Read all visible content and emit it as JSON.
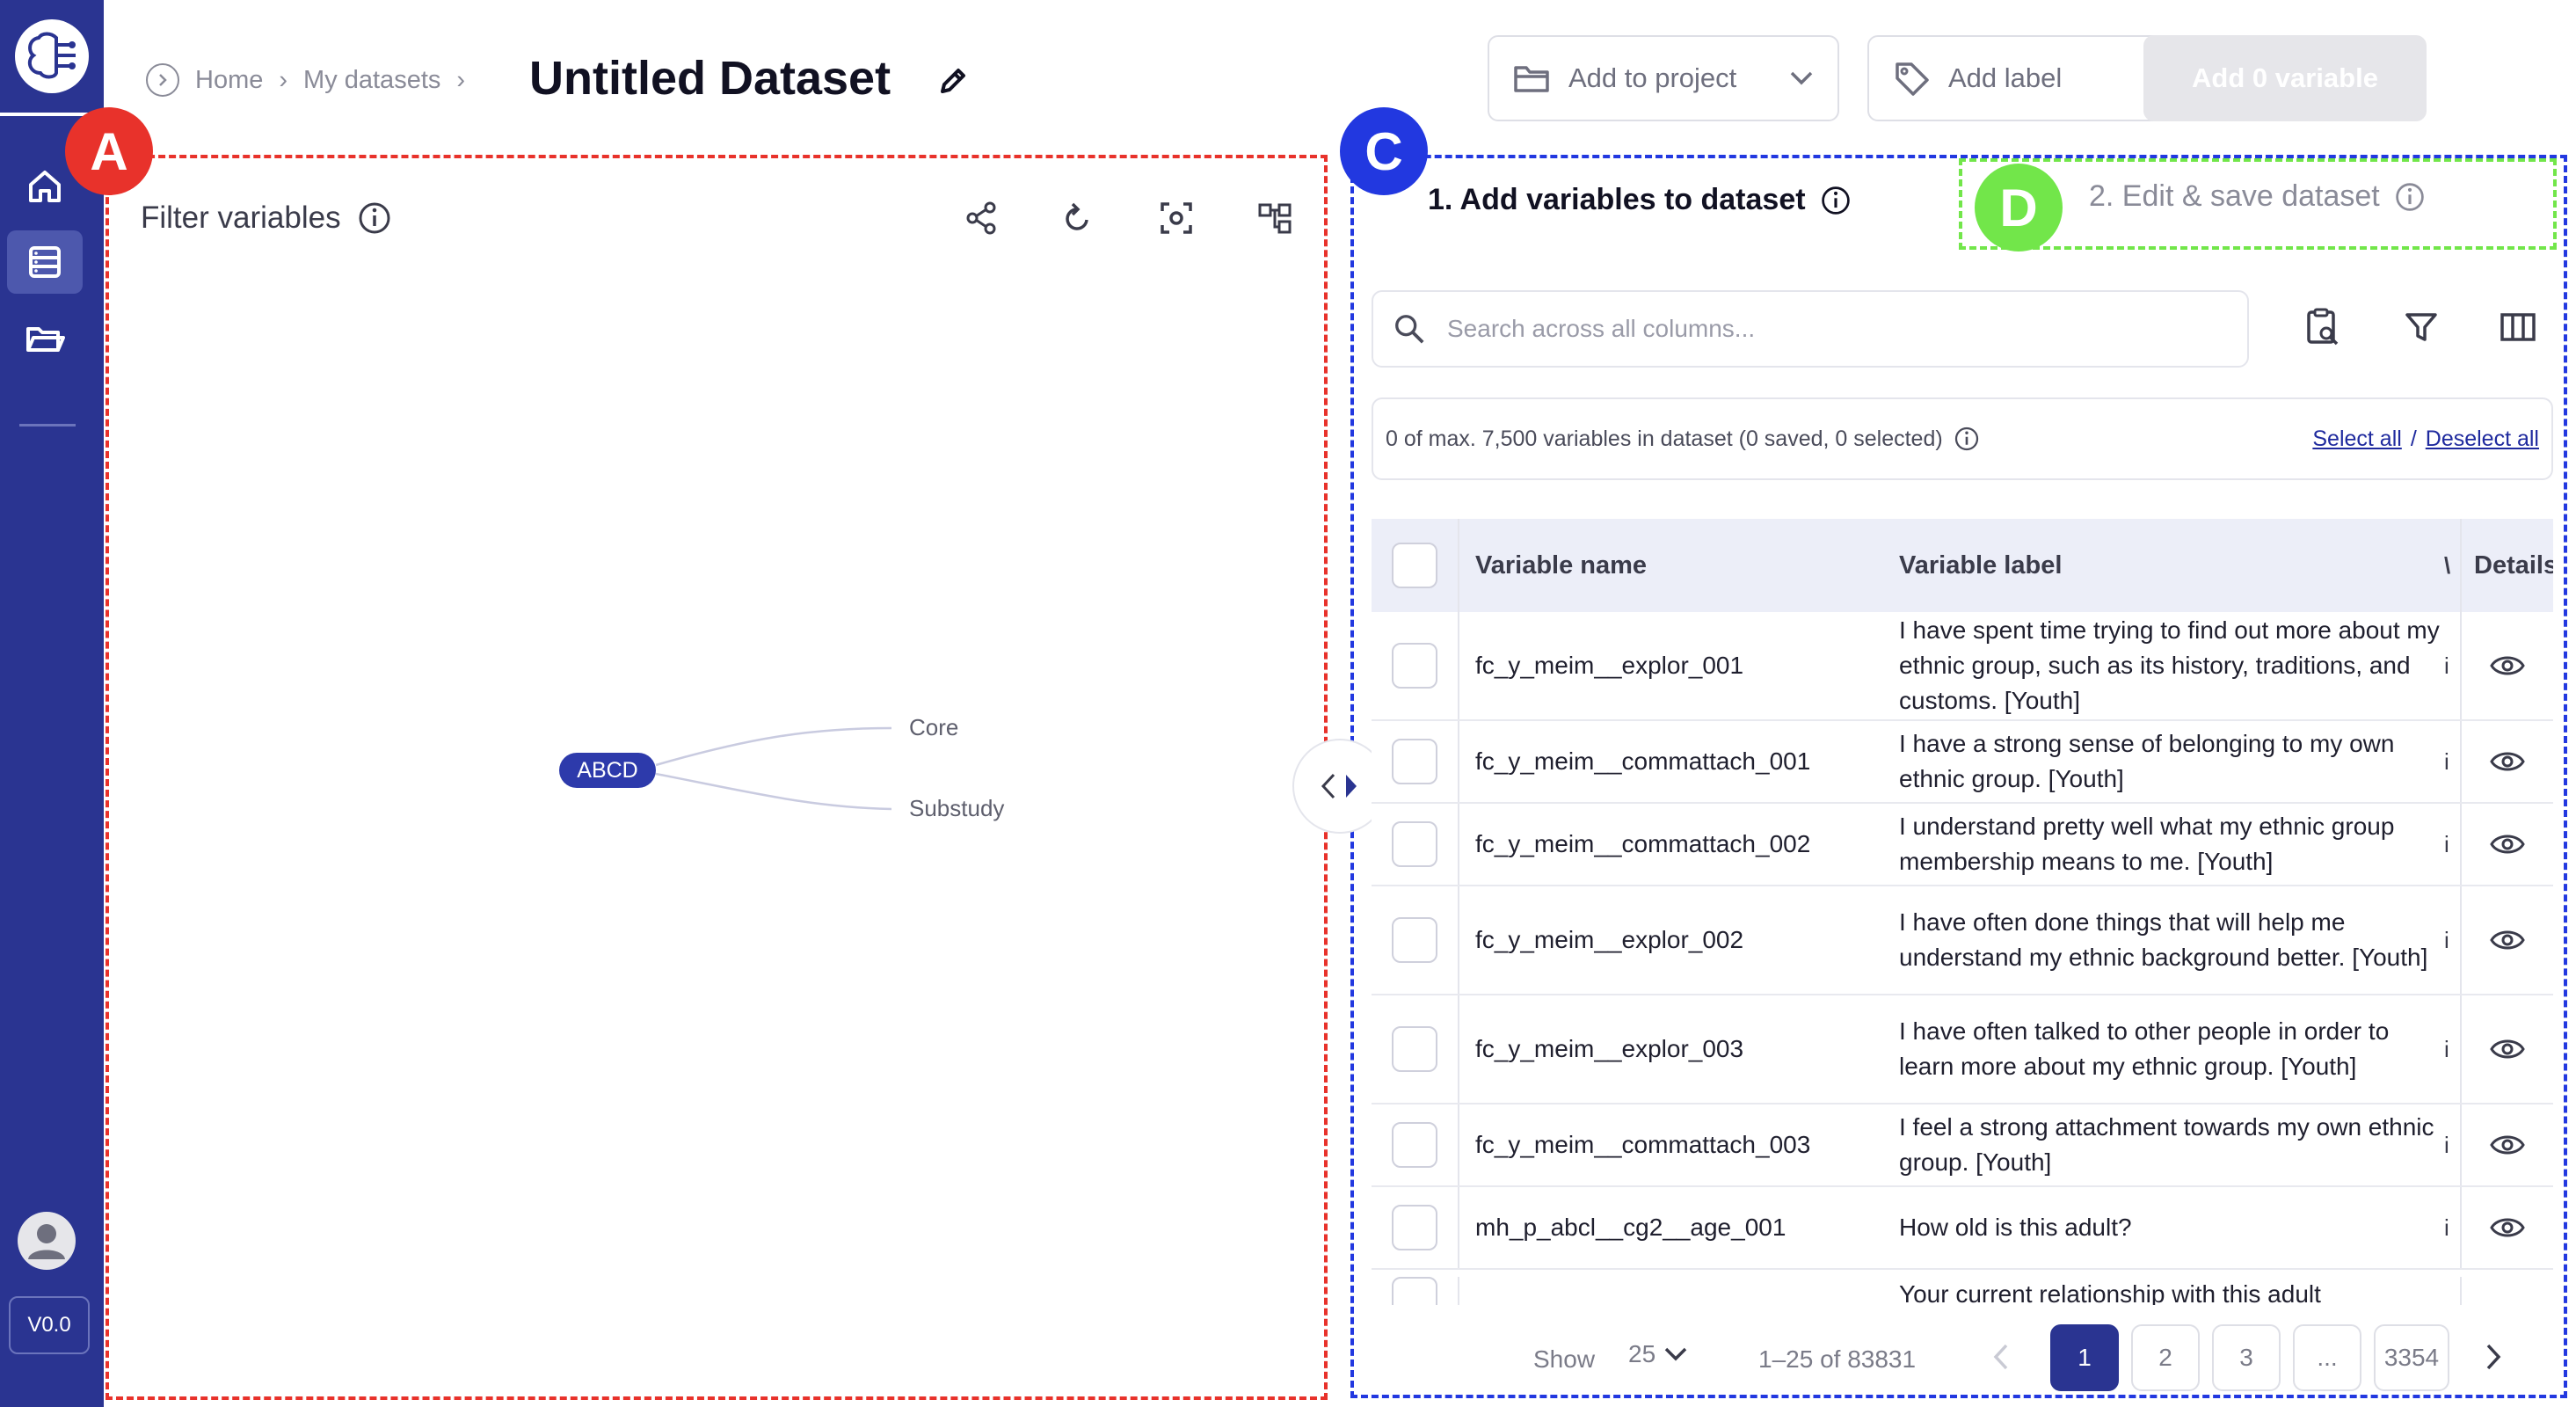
{
  "app": {
    "version": "V0.0"
  },
  "sidebar": {
    "items": [
      {
        "icon": "home-icon"
      },
      {
        "icon": "dataset-list-icon"
      },
      {
        "icon": "folder-icon"
      }
    ]
  },
  "header": {
    "breadcrumb": [
      "Home",
      "My datasets"
    ],
    "separator": "›",
    "title": "Untitled Dataset",
    "add_project": "Add to project",
    "add_label": "Add label",
    "add_variable": "Add 0 variable"
  },
  "annotations": {
    "a": "A",
    "c": "C",
    "d": "D"
  },
  "annotation_colors": {
    "a": "#e8322b",
    "c": "#2238e0",
    "d": "#72e64a"
  },
  "filter": {
    "title": "Filter variables",
    "tree": {
      "root": "ABCD",
      "children": [
        "Core",
        "Substudy"
      ]
    }
  },
  "steps": {
    "step1": "1. Add variables to dataset",
    "step2": "2. Edit & save dataset"
  },
  "search": {
    "placeholder": "Search across all columns..."
  },
  "summary": {
    "text": "0 of max. 7,500 variables in dataset (0 saved, 0 selected)",
    "select_all": "Select all",
    "divider": "/",
    "deselect_all": "Deselect all"
  },
  "table": {
    "headers": {
      "name": "Variable name",
      "label": "Variable label",
      "cut": "\\",
      "details": "Details"
    },
    "rows": [
      {
        "name": "fc_y_meim__explor_001",
        "label": "I have spent time trying to find out more about my ethnic group, such as its history, traditions, and customs. [Youth]",
        "cut": "i"
      },
      {
        "name": "fc_y_meim__commattach_001",
        "label": "I have a strong sense of belonging to my own ethnic group. [Youth]",
        "cut": "i"
      },
      {
        "name": "fc_y_meim__commattach_002",
        "label": "I understand pretty well what my ethnic group membership means to me. [Youth]",
        "cut": "i"
      },
      {
        "name": "fc_y_meim__explor_002",
        "label": "I have often done things that will help me understand my ethnic background better. [Youth]",
        "cut": "i"
      },
      {
        "name": "fc_y_meim__explor_003",
        "label": "I have often talked to other people in order to learn more about my ethnic group. [Youth]",
        "cut": "i"
      },
      {
        "name": "fc_y_meim__commattach_003",
        "label": "I feel a strong attachment towards my own ethnic group. [Youth]",
        "cut": "i"
      },
      {
        "name": "mh_p_abcl__cg2__age_001",
        "label": "How old is this adult?",
        "cut": "i"
      },
      {
        "name": "",
        "label": "Your current relationship with this adult",
        "cut": ""
      }
    ]
  },
  "pagination": {
    "show_label": "Show",
    "page_size": "25",
    "range": "1–25 of 83831",
    "pages": [
      "1",
      "2",
      "3",
      "...",
      "3354"
    ],
    "current": "1"
  }
}
